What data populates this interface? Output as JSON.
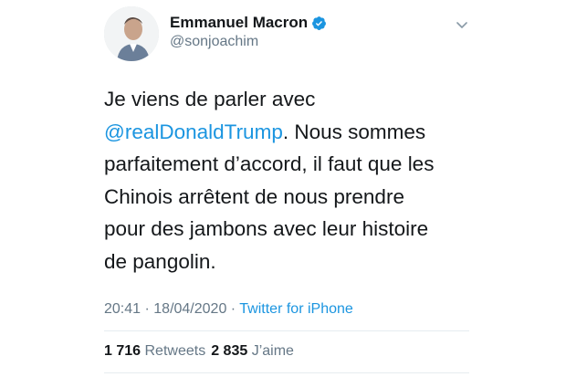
{
  "author": {
    "display_name": "Emmanuel Macron",
    "handle": "@sonjoachim",
    "verified": true,
    "avatar_icon": "profile-photo"
  },
  "icons": {
    "verified": "verified-badge-icon",
    "menu": "chevron-down-icon"
  },
  "tweet": {
    "text_before": "Je viens de parler avec\n",
    "mention": "@realDonaldTrump",
    "text_after": ". Nous sommes\nparfaitement d’accord, il faut que les\nChinois arrêtent de nous prendre\npour des jambons avec leur histoire\nde pangolin."
  },
  "meta": {
    "time": "20:41",
    "sep1": " · ",
    "date": "18/04/2020",
    "sep2": " · ",
    "source": "Twitter for iPhone"
  },
  "stats": {
    "retweets_count": "1 716",
    "retweets_label": "Retweets",
    "likes_count": "2 835",
    "likes_label": "J’aime"
  },
  "colors": {
    "text": "#14171a",
    "secondary": "#657786",
    "accent": "#1b95e0",
    "divider": "#e6ecf0"
  }
}
